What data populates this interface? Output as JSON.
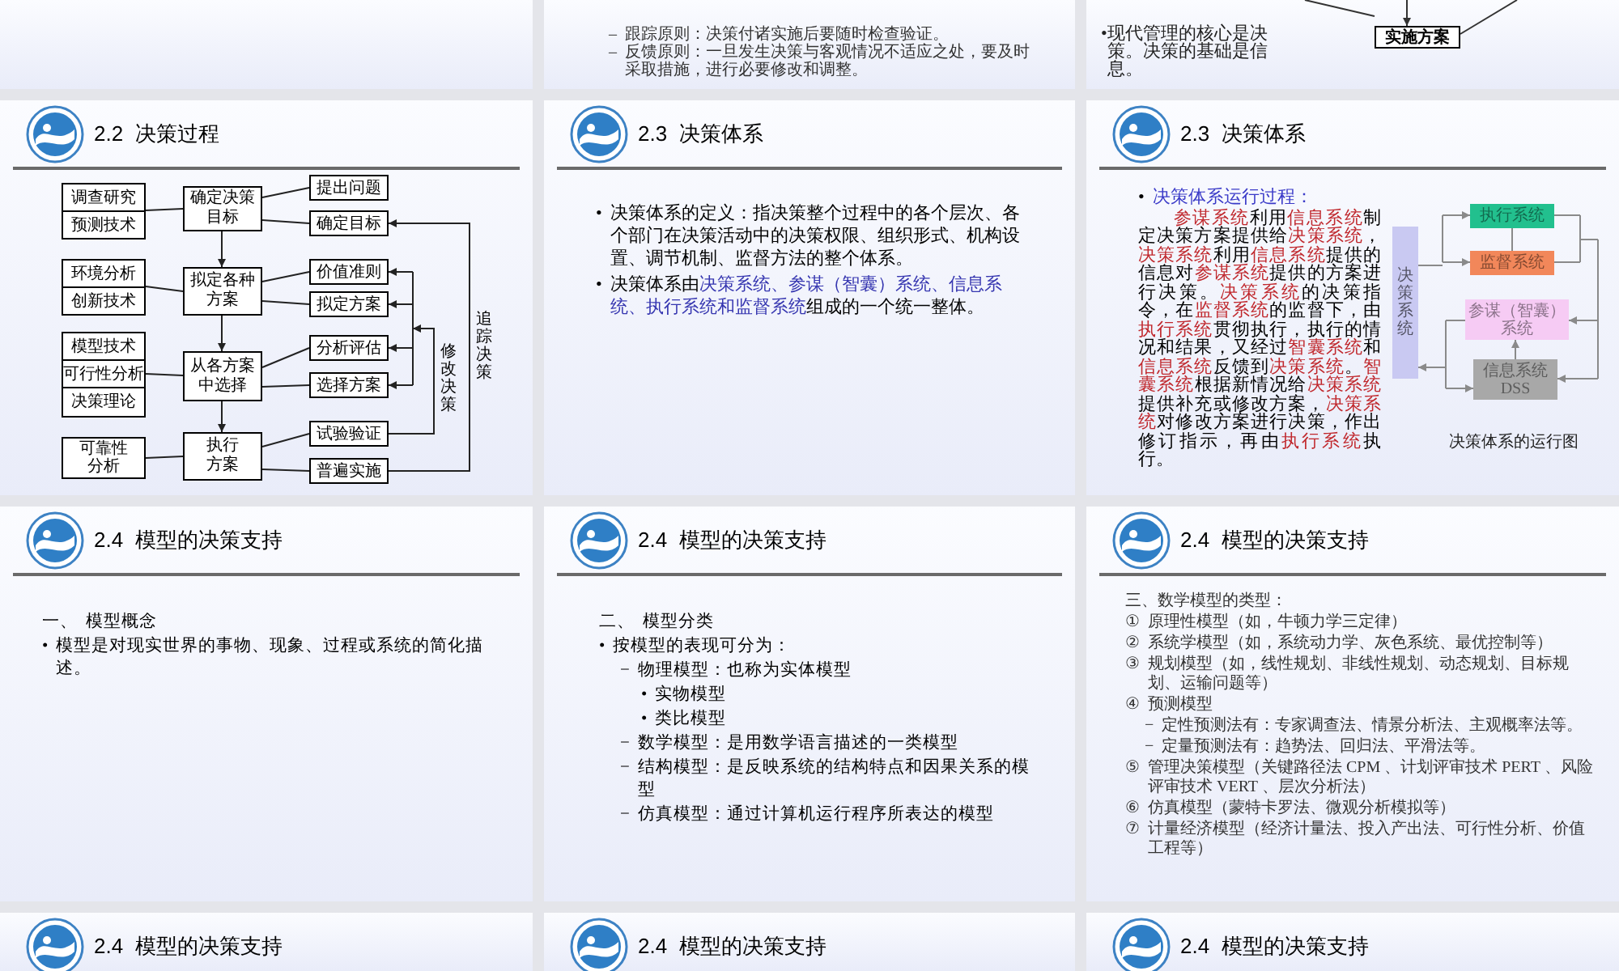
{
  "slides": [
    {
      "kind": "blank"
    },
    {
      "kind": "list",
      "items": [
        {
          "marker": "–",
          "text": "跟踪原则：决策付诸实施后要随时检查验证。"
        },
        {
          "marker": "–",
          "text": "反馈原则：一旦发生决策与客观情况不适应之处，要及时采取措施，进行必要修改和调整。"
        }
      ]
    },
    {
      "kind": "partial-diagram",
      "items": [
        {
          "marker": "•",
          "text": "现代管理的核心是决策。决策的基础是信息。"
        }
      ],
      "box": "实施方案"
    },
    {
      "kind": "flowchart",
      "title": "2.2  决策过程",
      "inputs": [
        [
          "调查研究",
          "预测技术"
        ],
        [
          "环境分析",
          "创新技术"
        ],
        [
          "模型技术",
          "可行性分析",
          "决策理论"
        ],
        [
          "可靠性分析"
        ]
      ],
      "steps": [
        "确定决策目标",
        "拟定各种方案",
        "从各方案中选择",
        "执行方案"
      ],
      "outcomes": [
        [
          "提出问题",
          "确定目标"
        ],
        [
          "价值准则",
          "拟定方案"
        ],
        [
          "分析评估",
          "选择方案"
        ],
        [
          "试验验证",
          "普遍实施"
        ]
      ],
      "loops": [
        "修改决策",
        "追踪决策"
      ]
    },
    {
      "kind": "list",
      "title": "2.3  决策体系",
      "items": [
        {
          "marker": "•",
          "segments": [
            {
              "text": "决策体系的定义：指决策整个过程中的各个层次、各个部门在决策活动中的决策权限、组织形式、机构设置、调节机制、监督方法的整个体系。"
            }
          ]
        },
        {
          "marker": "•",
          "segments": [
            {
              "text": "决策体系由"
            },
            {
              "text": "决策系统、参谋（智囊）系统、信息系统、执行系统和监督系统",
              "color": "#3636b0"
            },
            {
              "text": "组成的一个统一整体。"
            }
          ]
        }
      ]
    },
    {
      "kind": "system",
      "title": "2.3  决策体系",
      "items": [
        {
          "kind": "line",
          "marker": "•",
          "segments": [
            {
              "text": "决策体系运行过程：",
              "color": "#3a3ac8"
            }
          ]
        },
        {
          "kind": "paragraph",
          "segments": [
            {
              "text": "参谋系统",
              "color": "#c0282d"
            },
            {
              "text": "利用"
            },
            {
              "text": "信息系统",
              "color": "#c0282d"
            },
            {
              "text": "制定决策方案提供给"
            },
            {
              "text": "决策系统",
              "color": "#c0282d"
            },
            {
              "text": "，"
            },
            {
              "text": "决策系统",
              "color": "#c0282d"
            },
            {
              "text": "利用"
            },
            {
              "text": "信息系统",
              "color": "#c0282d"
            },
            {
              "text": "提供的信息对"
            },
            {
              "text": "参谋系统",
              "color": "#c0282d"
            },
            {
              "text": "提供的方案进行决策。"
            },
            {
              "text": "决策系统",
              "color": "#c0282d"
            },
            {
              "text": "的决策指令，在"
            },
            {
              "text": "监督系统",
              "color": "#c0282d"
            },
            {
              "text": "的监督下，由"
            },
            {
              "text": "执行系统",
              "color": "#c0282d"
            },
            {
              "text": "贯彻执行，执行的情况和结果，又经过"
            },
            {
              "text": "智囊系统",
              "color": "#c0282d"
            },
            {
              "text": "和"
            },
            {
              "text": "信息系统",
              "color": "#c0282d"
            },
            {
              "text": "反馈到"
            },
            {
              "text": "决策系统",
              "color": "#c0282d"
            },
            {
              "text": "。"
            },
            {
              "text": "智囊系统",
              "color": "#c0282d"
            },
            {
              "text": "根据新情况给"
            },
            {
              "text": "决策系统",
              "color": "#c0282d"
            },
            {
              "text": "提供补充或修改方案，"
            },
            {
              "text": "决策系统",
              "color": "#c0282d"
            },
            {
              "text": "对修改方案进行决策，作出修订指示，再由"
            },
            {
              "text": "执行系统",
              "color": "#c0282d"
            },
            {
              "text": "执行。"
            }
          ]
        }
      ],
      "diagram": {
        "main": "决策系统",
        "boxes": [
          {
            "text": "执行系统",
            "color": "#22c08e"
          },
          {
            "text": "监督系统",
            "color": "#f2875a"
          },
          {
            "text": "参谋（智囊）系统",
            "color": "#f6cbf4"
          },
          {
            "text": "信息系统 DSS",
            "color": "#a8a8a8"
          }
        ],
        "caption": "决策体系的运行图"
      }
    },
    {
      "kind": "list",
      "title": "2.4  模型的决策支持",
      "items": [
        {
          "marker": "一、",
          "text": "模型概念"
        },
        {
          "marker": "•",
          "text": "模型是对现实世界的事物、现象、过程或系统的简化描述。"
        }
      ]
    },
    {
      "kind": "list",
      "title": "2.4  模型的决策支持",
      "items": [
        {
          "marker": "二、",
          "text": "模型分类"
        },
        {
          "marker": "•",
          "text": "按模型的表现可分为：",
          "children": [
            {
              "marker": "−",
              "text": "物理模型：也称为实体模型",
              "children": [
                {
                  "marker": "•",
                  "text": "实物模型"
                },
                {
                  "marker": "•",
                  "text": "类比模型"
                }
              ]
            },
            {
              "marker": "−",
              "text": "数学模型：是用数学语言描述的一类模型"
            },
            {
              "marker": "−",
              "text": "结构模型：是反映系统的结构特点和因果关系的模型"
            },
            {
              "marker": "−",
              "text": "仿真模型：通过计算机运行程序所表达的模型"
            }
          ]
        }
      ]
    },
    {
      "kind": "list",
      "title": "2.4  模型的决策支持",
      "items": [
        {
          "text": "三、数学模型的类型："
        },
        {
          "marker": "①",
          "text": "原理性模型（如，牛顿力学三定律）"
        },
        {
          "marker": "②",
          "text": "系统学模型（如，系统动力学、灰色系统、最优控制等）"
        },
        {
          "marker": "③",
          "text": "规划模型（如，线性规划、非线性规划、动态规划、目标规划、运输问题等）"
        },
        {
          "marker": "④",
          "text": "预测模型",
          "children": [
            {
              "marker": "−",
              "text": "定性预测法有：专家调查法、情景分析法、主观概率法等。"
            },
            {
              "marker": "−",
              "text": "定量预测法有：趋势法、回归法、平滑法等。"
            }
          ]
        },
        {
          "marker": "⑤",
          "text": "管理决策模型（关键路径法 CPM 、计划评审技术 PERT 、风险评审技术 VERT 、层次分析法）"
        },
        {
          "marker": "⑥",
          "text": "仿真模型（蒙特卡罗法、微观分析模拟等）"
        },
        {
          "marker": "⑦",
          "text": "计量经济模型（经济计量法、投入产出法、可行性分析、价值工程等）"
        }
      ]
    },
    {
      "kind": "list",
      "title": "2.4  模型的决策支持"
    },
    {
      "kind": "list",
      "title": "2.4  模型的决策支持"
    },
    {
      "kind": "list",
      "title": "2.4  模型的决策支持"
    }
  ]
}
